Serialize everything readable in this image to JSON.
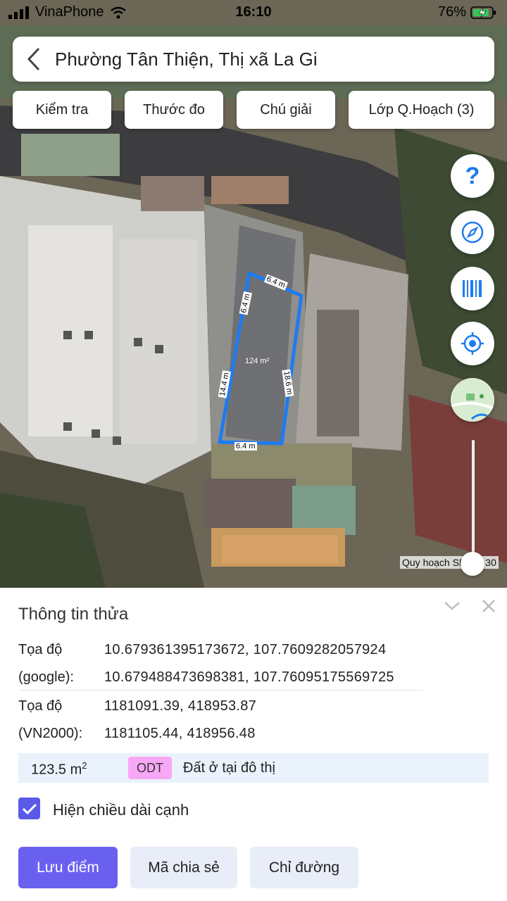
{
  "status_bar": {
    "carrier": "VinaPhone",
    "time": "16:10",
    "battery": "76%"
  },
  "header": {
    "title": "Phường Tân Thiện, Thị xã La Gi"
  },
  "toolbar": {
    "check": "Kiểm tra",
    "ruler": "Thước đo",
    "legend": "Chú giải",
    "planning_layer": "Lớp Q.Hoạch (3)"
  },
  "map": {
    "edges": {
      "top": "6.4 m",
      "left_top": "6.4 m",
      "left": "14.4 m",
      "right": "18.6 m",
      "bottom": "6.4 m"
    },
    "area_label": "124 m²",
    "slider_label": "Quy hoạch SD",
    "slider_value": "30",
    "accent_color": "#1e7bf0"
  },
  "panel": {
    "title": "Thông tin thửa",
    "coord_google_label_1": "Tọa độ",
    "coord_google_label_2": "(google):",
    "coord_google_1": "10.679361395173672, 107.7609282057924",
    "coord_google_2": "10.679488473698381, 107.76095175569725",
    "coord_vn_label_1": "Tọa độ",
    "coord_vn_label_2": "(VN2000):",
    "coord_vn_1": "1181091.39, 418953.87",
    "coord_vn_2": "1181105.44, 418956.48",
    "area": "123.5 m",
    "area_unit_sup": "2",
    "land_code": "ODT",
    "land_type": "Đất ở tại đô thị",
    "checkbox_label": "Hiện chiều dài cạnh",
    "checkbox_checked": true
  },
  "actions": {
    "save": "Lưu điểm",
    "share": "Mã chia sẻ",
    "directions": "Chỉ đường"
  }
}
